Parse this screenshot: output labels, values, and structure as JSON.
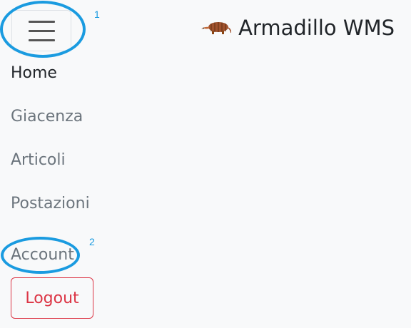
{
  "navbar": {
    "brand_icon": "armadillo-icon",
    "brand_text": "Armadillo WMS",
    "toggler_icon": "hamburger-menu-icon"
  },
  "nav": {
    "items": [
      {
        "label": "Home",
        "active": true
      },
      {
        "label": "Giacenza",
        "active": false
      },
      {
        "label": "Articoli",
        "active": false
      },
      {
        "label": "Postazioni",
        "active": false
      },
      {
        "label": "Account",
        "active": false
      }
    ],
    "logout_label": "Logout"
  },
  "annotations": {
    "marker_1": "1",
    "marker_2": "2",
    "color": "#1a9be0"
  },
  "colors": {
    "background": "#f8f9fa",
    "danger": "#dc3545",
    "link_muted": "#6c757d",
    "link_active": "#212529"
  }
}
